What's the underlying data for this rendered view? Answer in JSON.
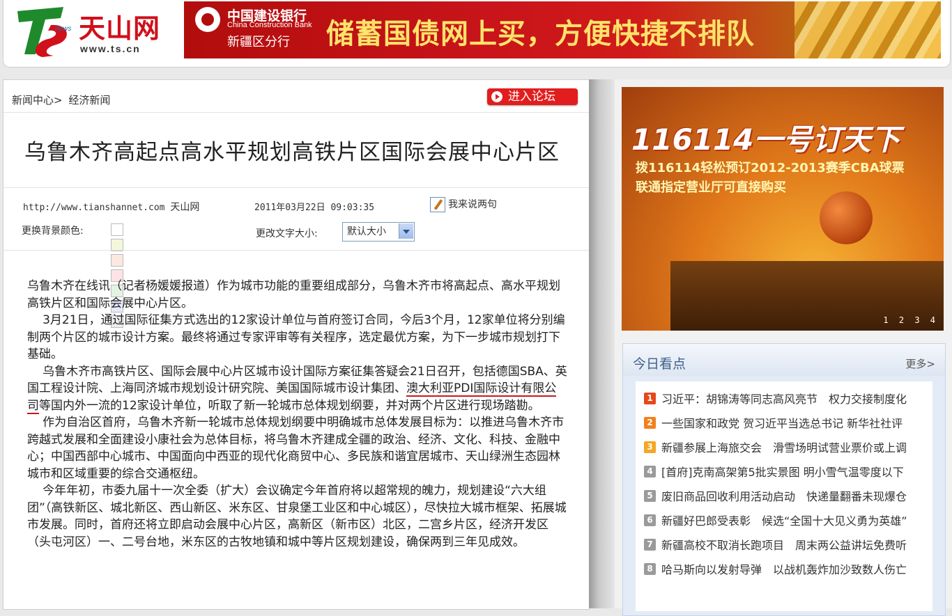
{
  "header": {
    "logo_brand": "天山网",
    "logo_domain": "www.ts.cn",
    "banner": {
      "bank_name_cn": "中国建设银行",
      "bank_name_en": "China Construction Bank",
      "branch": "新疆区分行",
      "slogan": "储蓄国债网上买，方便快捷不排队"
    }
  },
  "breadcrumb": {
    "home": "新闻中心>",
    "section": "经济新闻"
  },
  "forum_button": "进入论坛",
  "article": {
    "title": "乌鲁木齐高起点高水平规划高铁片区国际会展中心片区",
    "source_url": "http://www.tianshannet.com",
    "source_name": "天山网",
    "datetime": "2011年03月22日 09:03:35",
    "comment_link": "我来说两句",
    "bg_color_label": "更换背景颜色:",
    "bg_colors": [
      "#ffffff",
      "#f4f7dc",
      "#fbe8de",
      "#fde3e3",
      "#e4f3e2",
      "#e6e8fb",
      "#ececec"
    ],
    "font_size_label": "更改文字大小:",
    "font_size_value": "默认大小",
    "paragraphs": {
      "p1": "乌鲁木齐在线讯（记者杨媛媛报道）作为城市功能的重要组成部分，乌鲁木齐市将高起点、高水平规划高铁片区和国际会展中心片区。",
      "p2": "3月21日，通过国际征集方式选出的12家设计单位与首府签订合同，今后3个月，12家单位将分别编制两个片区的城市设计方案。最终将通过专家评审等有关程序，选定最优方案，为下一步城市规划打下基础。",
      "p3a": "乌鲁木齐市高铁片区、国际会展中心片区城市设计国际方案征集答疑会21日召开，包括德国SBA、英国工程设计院、上海同济城市规划设计研究院、美国国际城市设计集团、",
      "p3link": "澳大利亚PDI国际设计有限公司",
      "p3b": "等国内外一流的12家设计单位，听取了新一轮城市总体规划纲要，并对两个片区进行现场踏勘。",
      "p4": "作为自治区首府，乌鲁木齐新一轮城市总体规划纲要中明确城市总体发展目标为：以推进乌鲁木齐市跨越式发展和全面建设小康社会为总体目标，将乌鲁木齐建成全疆的政治、经济、文化、科技、金融中心；中国西部中心城市、中国面向中西亚的现代化商贸中心、多民族和谐宜居城市、天山绿洲生态园林城市和区域重要的综合交通枢纽。",
      "p5": "今年年初，市委九届十一次全委（扩大）会议确定今年首府将以超常规的魄力，规划建设“六大组团”（高铁新区、城北新区、西山新区、米东区、甘泉堡工业区和中心城区），尽快拉大城市框架、拓展城市发展。同时，首府还将立即启动会展中心片区，高新区（新市区）北区，二宫乡片区，经济开发区（头屯河区）一、二号台地，米东区的古牧地镇和城中等片区规划建设，确保两到三年见成效。"
    }
  },
  "sidebar": {
    "ad": {
      "headline": "116114一号订天下",
      "line1": "拨116114轻松预订2012-2013赛季CBA球票",
      "line2": "联通指定营业厅可直接购买",
      "pager": "1 2 3 4"
    },
    "today": {
      "title": "今日看点",
      "more": "更多>",
      "items": [
        {
          "num": "1",
          "text": "习近平：胡锦涛等同志高风亮节　权力交接制度化"
        },
        {
          "num": "2",
          "text": "一些国家和政党 贺习近平当选总书记 新华社社评"
        },
        {
          "num": "3",
          "text": "新疆参展上海旅交会　滑雪场明试营业票价或上调"
        },
        {
          "num": "4",
          "text": "[首府]克南高架第5批实景图 明小雪气温零度以下"
        },
        {
          "num": "5",
          "text": "废旧商品回收利用活动启动　快递量翻番未现爆仓"
        },
        {
          "num": "6",
          "text": "新疆好巴郎受表彰　候选“全国十大见义勇为英雄”"
        },
        {
          "num": "7",
          "text": "新疆高校不取消长跑项目　周末两公益讲坛免费听"
        },
        {
          "num": "8",
          "text": "哈马斯向以发射导弹　以战机轰炸加沙致数人伤亡"
        }
      ]
    }
  },
  "colors": {
    "brand_red": "#d0101a",
    "num_top3": "#e8471b",
    "num_rest": "#9a9a9a"
  }
}
